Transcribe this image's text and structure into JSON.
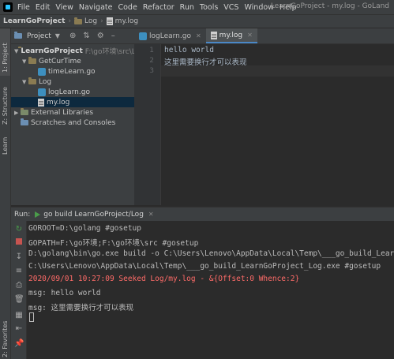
{
  "menubar": {
    "items": [
      "File",
      "Edit",
      "View",
      "Navigate",
      "Code",
      "Refactor",
      "Run",
      "Tools",
      "VCS",
      "Window",
      "Help"
    ],
    "title": "LearnGoProject - my.log - GoLand"
  },
  "navbar": {
    "project": "LearnGoProject",
    "folder": "Log",
    "file": "my.log"
  },
  "leftstrip": {
    "project": "1: Project",
    "structure": "Z: Structure",
    "learn": "Learn",
    "favorites": "2: Favorites"
  },
  "project_panel": {
    "label": "Project",
    "tree": [
      {
        "label": "LearnGoProject",
        "path": "F:\\go环境\\src\\Le"
      },
      {
        "label": "GetCurTime"
      },
      {
        "label": "timeLearn.go"
      },
      {
        "label": "Log"
      },
      {
        "label": "logLearn.go"
      },
      {
        "label": "my.log"
      },
      {
        "label": "External Libraries"
      },
      {
        "label": "Scratches and Consoles"
      }
    ]
  },
  "editor": {
    "tabs": [
      {
        "label": "logLearn.go",
        "active": false
      },
      {
        "label": "my.log",
        "active": true
      }
    ],
    "lines": [
      "hello world",
      "这里需要换行才可以表现",
      ""
    ],
    "line_numbers": [
      "1",
      "2",
      "3"
    ]
  },
  "run_panel": {
    "label": "Run:",
    "tab": "go build LearnGoProject/Log",
    "output": [
      {
        "text": "GOROOT=D:\\golang #gosetup",
        "color": "#bbbbbb"
      },
      {
        "text": "GOPATH=F:\\go环境;F:\\go环境\\src #gosetup",
        "color": "#bbbbbb"
      },
      {
        "text": "D:\\golang\\bin\\go.exe build -o C:\\Users\\Lenovo\\AppData\\Local\\Temp\\___go_build_LearnGoProject_Log.exe",
        "color": "#bbbbbb"
      },
      {
        "text": "C:\\Users\\Lenovo\\AppData\\Local\\Temp\\___go_build_LearnGoProject_Log.exe #gosetup",
        "color": "#bbbbbb"
      },
      {
        "text": "2020/09/01 10:27:09 Seeked Log/my.log - &{Offset:0 Whence:2}",
        "color": "#ff6b68"
      },
      {
        "text": "",
        "color": "#bbbbbb"
      },
      {
        "text": "msg: hello world",
        "color": "#bbbbbb"
      },
      {
        "text": "msg: 这里需要换行才可以表现",
        "color": "#bbbbbb"
      }
    ]
  },
  "colors": {
    "background": "#2b2b2b",
    "panel": "#3c3f41",
    "selection": "#0d293e",
    "error_text": "#ff6b68",
    "accent": "#4a88c7"
  }
}
